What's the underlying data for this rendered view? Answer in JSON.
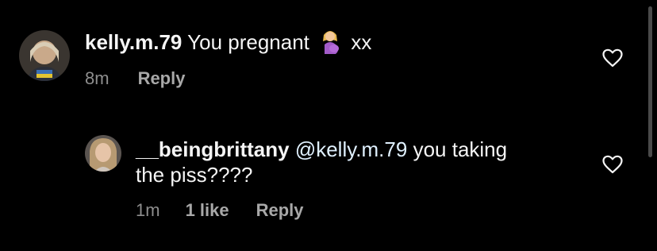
{
  "comments": [
    {
      "username": "kelly.m.79",
      "text": "You pregnant",
      "emoji": "pregnant-woman-emoji",
      "text_suffix": "xx",
      "time": "8m",
      "reply_label": "Reply"
    },
    {
      "username": "__beingbrittany",
      "mention": "@kelly.m.79",
      "text_line1": "you taking",
      "text_line2": "the piss????",
      "time": "1m",
      "likes": "1 like",
      "reply_label": "Reply"
    }
  ],
  "colors": {
    "background": "#000000",
    "text": "#f5f5f5",
    "secondary": "#8e8e8e",
    "mention": "#e0f1ff"
  },
  "icons": {
    "like": "heart-outline-icon"
  }
}
